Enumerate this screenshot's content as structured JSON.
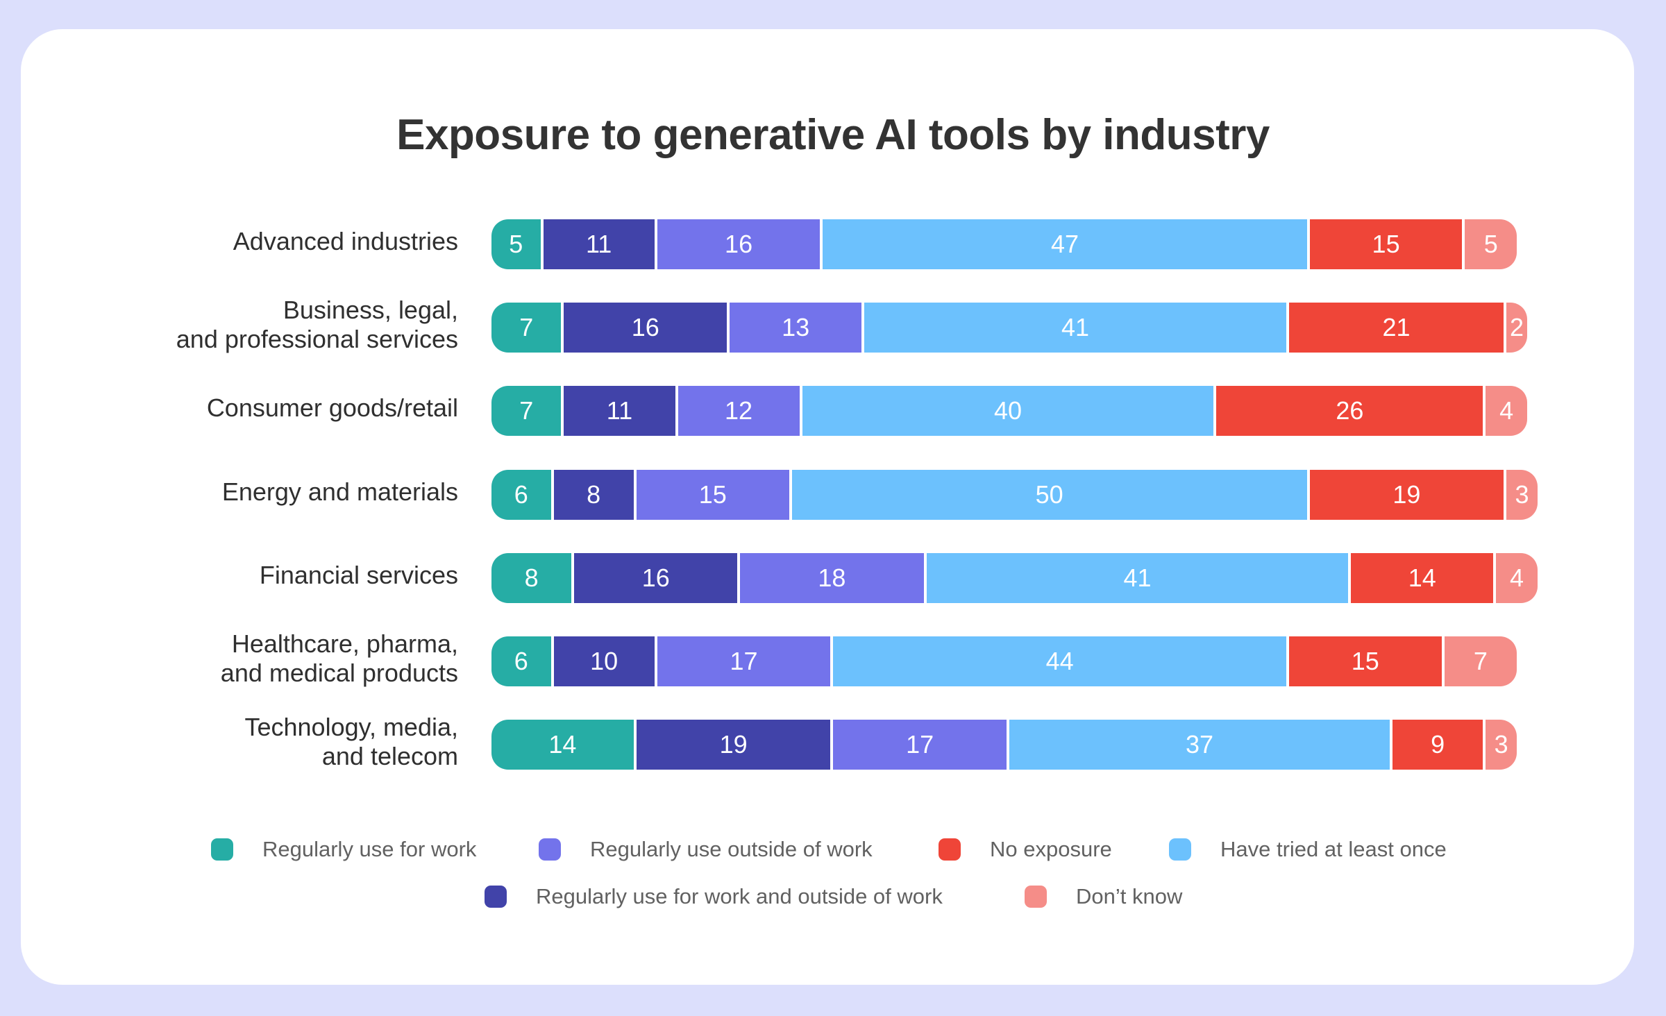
{
  "chart_data": {
    "type": "bar",
    "orientation": "horizontal",
    "stacked": true,
    "title": "Exposure to generative AI tools by industry",
    "xlabel": "",
    "ylabel": "",
    "xlim": [
      0,
      100
    ],
    "grid": false,
    "legend_position": "bottom",
    "categories": [
      "Advanced industries",
      "Business, legal,\nand professional services",
      "Consumer goods/retail",
      "Energy and materials",
      "Financial services",
      "Healthcare, pharma,\nand medical products",
      "Technology, media,\nand telecom"
    ],
    "series": [
      {
        "name": "Regularly use for work",
        "color": "#26ada5",
        "values": [
          5,
          7,
          7,
          6,
          8,
          6,
          14
        ]
      },
      {
        "name": "Regularly use for work and outside of work",
        "color": "#4143a9",
        "values": [
          11,
          16,
          11,
          8,
          16,
          10,
          19
        ]
      },
      {
        "name": "Regularly use outside of work",
        "color": "#7373eb",
        "values": [
          16,
          13,
          12,
          15,
          18,
          17,
          17
        ]
      },
      {
        "name": "Have tried at least once",
        "color": "#6cc1fd",
        "values": [
          47,
          41,
          40,
          50,
          41,
          44,
          37
        ]
      },
      {
        "name": "No exposure",
        "color": "#ef4538",
        "values": [
          15,
          21,
          26,
          19,
          14,
          15,
          9
        ]
      },
      {
        "name": "Don’t know",
        "color": "#f58d88",
        "values": [
          5,
          2,
          4,
          3,
          4,
          7,
          3
        ]
      }
    ]
  },
  "legend": {
    "rows": [
      [
        {
          "label": "Regularly use for work",
          "color": "#26ada5"
        },
        {
          "label": "Regularly use outside of work",
          "color": "#7373eb"
        },
        {
          "label": "No exposure",
          "color": "#ef4538"
        },
        {
          "label": "Have tried at least once",
          "color": "#6cc1fd"
        }
      ],
      [
        {
          "label": "Regularly use for work and outside of work",
          "color": "#4143a9"
        },
        {
          "label": "Don’t know",
          "color": "#f58d88"
        }
      ]
    ]
  },
  "colors": {
    "background": "#dcdffc",
    "card": "#ffffff",
    "title_text": "#333333",
    "label_text": "#2f2f2f",
    "legend_text": "#616161"
  }
}
